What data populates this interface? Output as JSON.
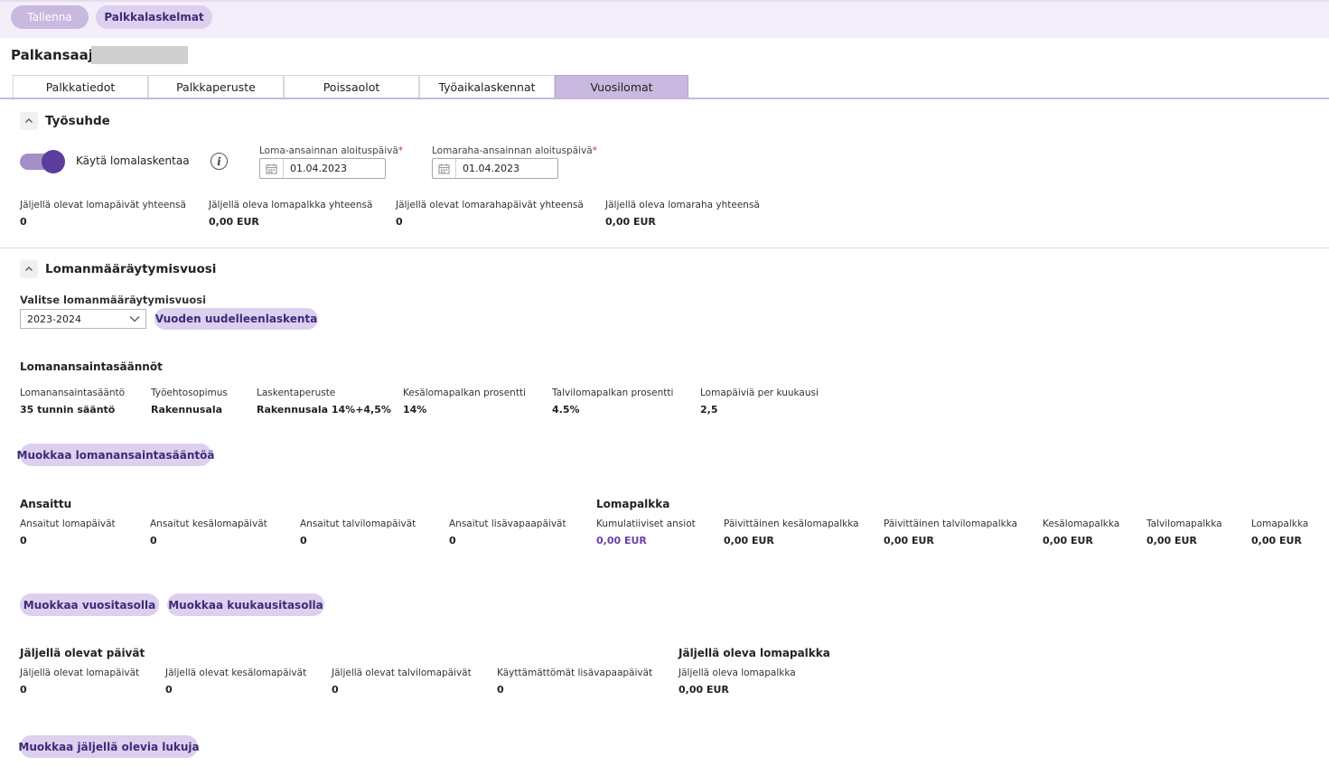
{
  "toolbar": {
    "save_label": "Tallenna",
    "payslips_label": "Palkkalaskelmat"
  },
  "header": {
    "title": "Palkansaaja"
  },
  "tabs": [
    "Palkkatiedot",
    "Palkkaperuste",
    "Poissaolot",
    "Työaikalaskennat",
    "Vuosilomat"
  ],
  "active_tab": "Vuosilomat",
  "employment": {
    "section_title": "Työsuhde",
    "toggle_label": "Käytä lomalaskentaa",
    "toggle_on": true,
    "info_glyph": "i",
    "holiday_accrual_start": {
      "label": "Loma-ansainnan aloituspäivä",
      "required_mark": "*",
      "value": "01.04.2023"
    },
    "holiday_pay_accrual_start": {
      "label": "Lomaraha-ansainnan aloituspäivä",
      "required_mark": "*",
      "value": "01.04.2023"
    },
    "summary": [
      {
        "label": "Jäljellä olevat lomapäivät yhteensä",
        "value": "0"
      },
      {
        "label": "Jäljellä oleva lomapalkka yhteensä",
        "value": "0,00 EUR"
      },
      {
        "label": "Jäljellä olevat lomarahapäivät yhteensä",
        "value": "0"
      },
      {
        "label": "Jäljellä oleva lomaraha yhteensä",
        "value": "0,00 EUR"
      }
    ]
  },
  "holiday_year": {
    "section_title": "Lomanmääräytymisvuosi",
    "select_label": "Valitse lomanmääräytymisvuosi",
    "selected_year": "2023-2024",
    "recalc_label": "Vuoden uudelleenlaskenta",
    "rules": {
      "title": "Lomanansaintasäännöt",
      "items": [
        {
          "label": "Lomanansaintasääntö",
          "value": "35 tunnin sääntö"
        },
        {
          "label": "Työehtosopimus",
          "value": "Rakennusala"
        },
        {
          "label": "Laskentaperuste",
          "value": "Rakennusala 14%+4,5%"
        },
        {
          "label": "Kesälomapalkan prosentti",
          "value": "14%"
        },
        {
          "label": "Talvilomapalkan prosentti",
          "value": "4.5%"
        },
        {
          "label": "Lomapäiviä per kuukausi",
          "value": "2,5"
        }
      ],
      "edit_label": "Muokkaa lomanansaintasääntöä"
    },
    "earned": {
      "title": "Ansaittu",
      "items": [
        {
          "label": "Ansaitut lomapäivät",
          "value": "0"
        },
        {
          "label": "Ansaitut kesälomapäivät",
          "value": "0"
        },
        {
          "label": "Ansaitut talvilomapäivät",
          "value": "0"
        },
        {
          "label": "Ansaitut lisävapaapäivät",
          "value": "0"
        }
      ]
    },
    "holiday_pay": {
      "title": "Lomapalkka",
      "items": [
        {
          "label": "Kumulatiiviset ansiot",
          "value": "0,00 EUR"
        },
        {
          "label": "Päivittäinen kesälomapalkka",
          "value": "0,00 EUR"
        },
        {
          "label": "Päivittäinen talvilomapalkka",
          "value": "0,00 EUR"
        },
        {
          "label": "Kesälomapalkka",
          "value": "0,00 EUR"
        },
        {
          "label": "Talvilomapalkka",
          "value": "0,00 EUR"
        },
        {
          "label": "Lomapalkka",
          "value": "0,00 EUR"
        }
      ]
    },
    "edit_yearly_label": "Muokkaa vuositasolla",
    "edit_monthly_label": "Muokkaa kuukausitasolla",
    "remaining_days": {
      "title": "Jäljellä olevat päivät",
      "items": [
        {
          "label": "Jäljellä olevat lomapäivät",
          "value": "0"
        },
        {
          "label": "Jäljellä olevat kesälomapäivät",
          "value": "0"
        },
        {
          "label": "Jäljellä olevat talvilomapäivät",
          "value": "0"
        },
        {
          "label": "Käyttämättömät lisävapaapäivät",
          "value": "0"
        }
      ]
    },
    "remaining_pay": {
      "title": "Jäljellä oleva lomapalkka",
      "items": [
        {
          "label": "Jäljellä oleva lomapalkka",
          "value": "0,00 EUR"
        }
      ]
    },
    "edit_remaining_label": "Muokkaa jäljellä olevia lukuja"
  },
  "colors": {
    "accent": "#5a3d9c",
    "pill_bg": "#dcd0ee",
    "active_tab": "#c9b8df",
    "cumulative_value": "#6a3fa6"
  },
  "icons": {
    "collapse": "chevron-up-icon",
    "calendar": "calendar-icon",
    "info": "info-icon",
    "dropdown": "chevron-down-icon"
  }
}
